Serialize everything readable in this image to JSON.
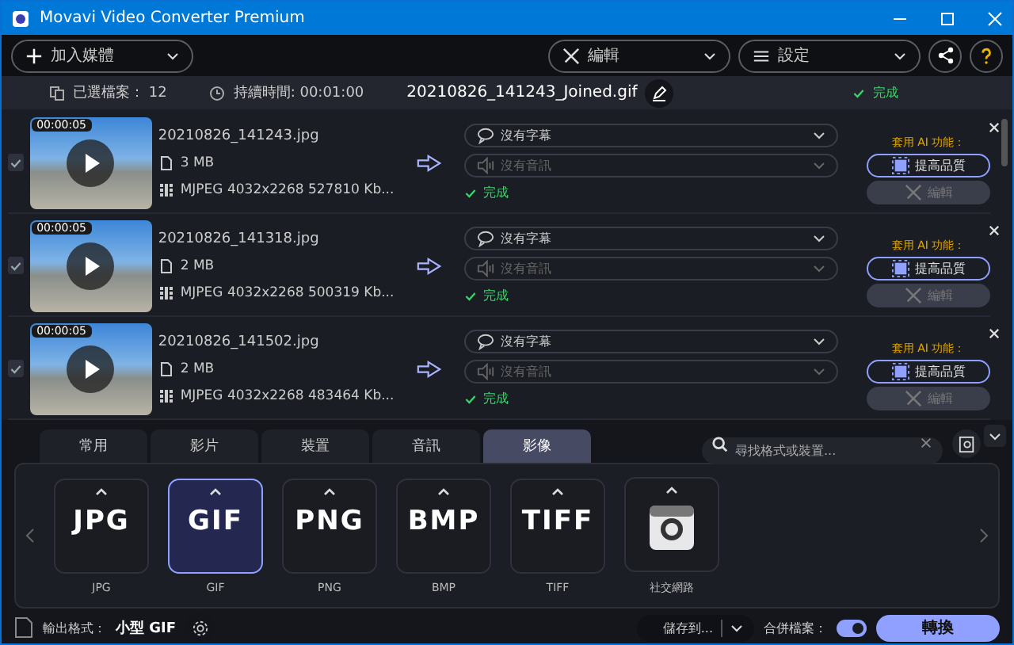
{
  "window": {
    "title": "Movavi Video Converter Premium"
  },
  "toolbar": {
    "add_media": "加入媒體",
    "edit": "編輯",
    "settings": "設定"
  },
  "info_bar": {
    "files_label": "已選檔案：",
    "files_count": "12",
    "duration": "持續時間: 00:01:00",
    "output_name": "20210826_141243_Joined.gif",
    "status": "完成"
  },
  "items": [
    {
      "checked": true,
      "duration": "00:00:05",
      "filename": "20210826_141243.jpg",
      "size": "3 MB",
      "codec": "MJPEG 4032x2268 527810 Kb...",
      "subtitle": "沒有字幕",
      "audio": "沒有音訊",
      "status": "完成",
      "ai_label": "套用 AI 功能：",
      "enhance": "提高品質",
      "edit": "編輯"
    },
    {
      "checked": true,
      "duration": "00:00:05",
      "filename": "20210826_141318.jpg",
      "size": "2 MB",
      "codec": "MJPEG 4032x2268 500319 Kb...",
      "subtitle": "沒有字幕",
      "audio": "沒有音訊",
      "status": "完成",
      "ai_label": "套用 AI 功能：",
      "enhance": "提高品質",
      "edit": "編輯"
    },
    {
      "checked": true,
      "duration": "00:00:05",
      "filename": "20210826_141502.jpg",
      "size": "2 MB",
      "codec": "MJPEG 4032x2268 483464 Kb...",
      "subtitle": "沒有字幕",
      "audio": "沒有音訊",
      "status": "完成",
      "ai_label": "套用 AI 功能：",
      "enhance": "提高品質",
      "edit": "編輯"
    }
  ],
  "format_tabs": [
    {
      "label": "常用",
      "selected": false
    },
    {
      "label": "影片",
      "selected": false
    },
    {
      "label": "裝置",
      "selected": false
    },
    {
      "label": "音訊",
      "selected": false
    },
    {
      "label": "影像",
      "selected": true
    }
  ],
  "search": {
    "placeholder": "尋找格式或裝置..."
  },
  "formats": [
    {
      "kind": "text",
      "logo": "JPG",
      "label": "JPG",
      "selected": false
    },
    {
      "kind": "text",
      "logo": "GIF",
      "label": "GIF",
      "selected": true
    },
    {
      "kind": "text",
      "logo": "PNG",
      "label": "PNG",
      "selected": false
    },
    {
      "kind": "text",
      "logo": "BMP",
      "label": "BMP",
      "selected": false
    },
    {
      "kind": "text",
      "logo": "TIFF",
      "label": "TIFF",
      "selected": false
    },
    {
      "kind": "camera",
      "label": "社交網路",
      "selected": false
    }
  ],
  "bottom_bar": {
    "output_label": "輸出格式：",
    "output_value": "小型 GIF",
    "save_to": "儲存到...",
    "merge_label": "合併檔案：",
    "merge_on": true,
    "convert": "轉換"
  }
}
